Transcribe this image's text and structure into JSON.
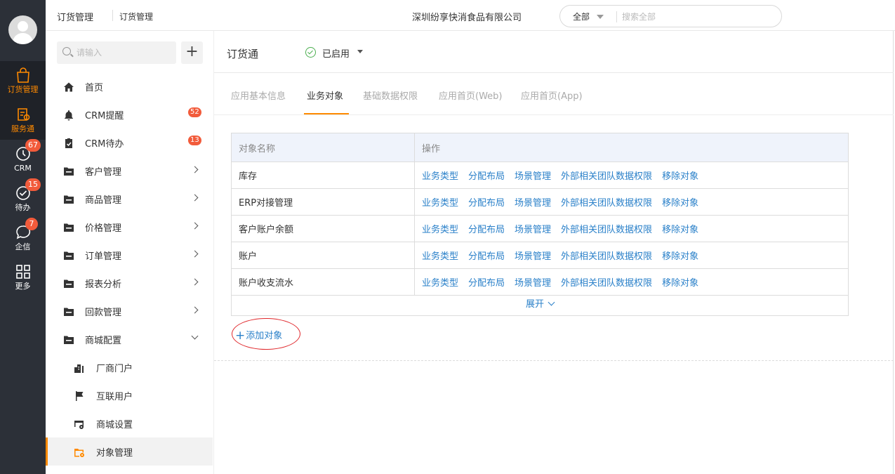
{
  "rail": {
    "items": [
      {
        "label": "订货管理",
        "icon": "bag-icon",
        "active": true
      },
      {
        "label": "服务通",
        "icon": "service-icon",
        "active": true
      },
      {
        "label": "CRM",
        "icon": "clock-icon",
        "badge": "67"
      },
      {
        "label": "待办",
        "icon": "check-circle-icon",
        "badge": "15"
      },
      {
        "label": "企信",
        "icon": "chat-icon",
        "badge": "7"
      },
      {
        "label": "更多",
        "icon": "grid-icon"
      }
    ],
    "accent": "#ff8a00"
  },
  "topbar": {
    "crumb1": "订货管理",
    "crumb2": "订货管理",
    "company": "深圳纷享快消食品有限公司",
    "search_scope": "全部",
    "search_placeholder": "搜索全部"
  },
  "sidebar": {
    "search_placeholder": "请输入",
    "add_label": "+",
    "items": [
      {
        "label": "首页",
        "icon": "home-icon"
      },
      {
        "label": "CRM提醒",
        "icon": "bell-icon",
        "badge": "52"
      },
      {
        "label": "CRM待办",
        "icon": "clipboard-icon",
        "badge": "13"
      },
      {
        "label": "客户管理",
        "icon": "folder-icon"
      },
      {
        "label": "商品管理",
        "icon": "folder-icon"
      },
      {
        "label": "价格管理",
        "icon": "folder-icon"
      },
      {
        "label": "订单管理",
        "icon": "folder-icon"
      },
      {
        "label": "报表分析",
        "icon": "folder-icon"
      },
      {
        "label": "回款管理",
        "icon": "folder-icon"
      },
      {
        "label": "商城配置",
        "icon": "folder-icon"
      },
      {
        "label": "厂商门户",
        "icon": "building-icon"
      },
      {
        "label": "互联用户",
        "icon": "flag-icon"
      },
      {
        "label": "商城设置",
        "icon": "store-settings-icon"
      },
      {
        "label": "对象管理",
        "icon": "object-manage-icon"
      }
    ]
  },
  "main": {
    "app_title": "订货通",
    "status": "已启用",
    "tabs": [
      "应用基本信息",
      "业务对象",
      "基础数据权限",
      "应用首页(Web)",
      "应用首页(App)"
    ],
    "active_tab": "业务对象",
    "table": {
      "headers": [
        "对象名称",
        "操作"
      ],
      "operations": [
        "业务类型",
        "分配布局",
        "场景管理",
        "外部相关团队数据权限",
        "移除对象"
      ],
      "rows": [
        "库存",
        "ERP对接管理",
        "客户账户余额",
        "账户",
        "账户收支流水"
      ]
    },
    "expand_label": "展开",
    "add_object_label": "添加对象",
    "link_color": "#2a80c9"
  }
}
